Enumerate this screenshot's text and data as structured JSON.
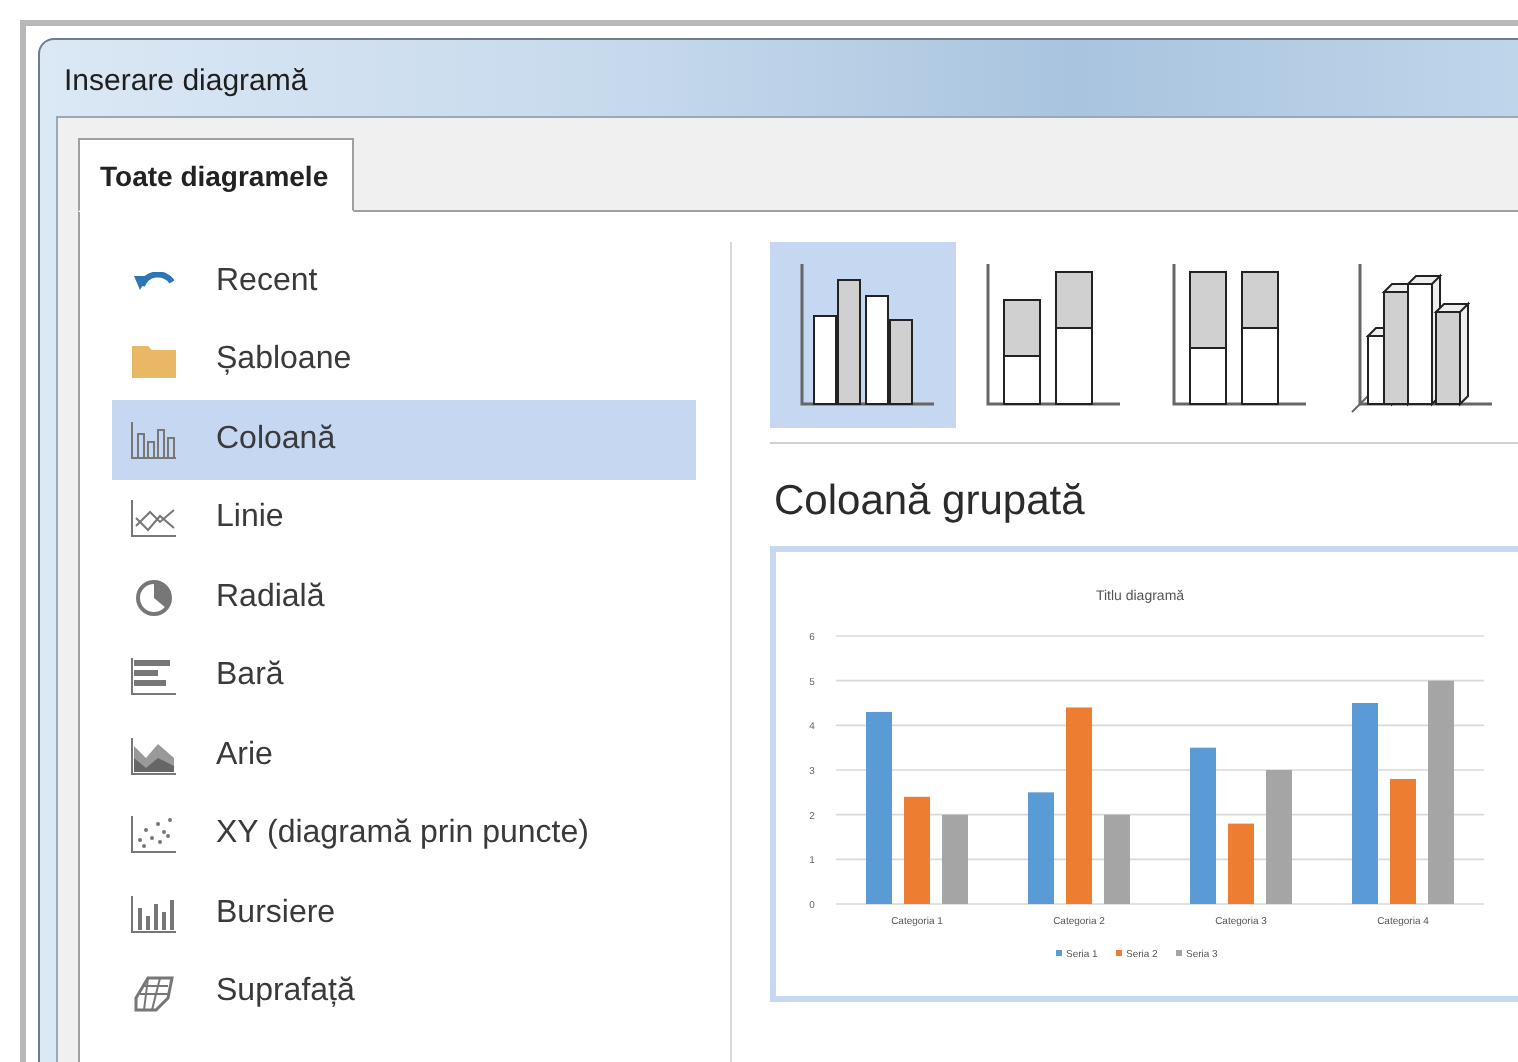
{
  "window": {
    "title": "Inserare diagramă"
  },
  "tabs": [
    {
      "label": "Toate diagramele",
      "selected": true
    }
  ],
  "sidebar": {
    "items": [
      {
        "label": "Recent",
        "kind": "recent",
        "selected": false
      },
      {
        "label": "Șabloane",
        "kind": "templates",
        "selected": false
      },
      {
        "label": "Coloană",
        "kind": "column",
        "selected": true
      },
      {
        "label": "Linie",
        "kind": "line",
        "selected": false
      },
      {
        "label": "Radială",
        "kind": "pie",
        "selected": false
      },
      {
        "label": "Bară",
        "kind": "bar",
        "selected": false
      },
      {
        "label": "Arie",
        "kind": "area",
        "selected": false
      },
      {
        "label": "XY (diagramă prin puncte)",
        "kind": "scatter",
        "selected": false
      },
      {
        "label": "Bursiere",
        "kind": "stock",
        "selected": false
      },
      {
        "label": "Suprafață",
        "kind": "surface",
        "selected": false
      }
    ]
  },
  "chart_types": [
    {
      "kind": "clustered",
      "selected": true
    },
    {
      "kind": "stacked",
      "selected": false
    },
    {
      "kind": "stacked100",
      "selected": false
    },
    {
      "kind": "column3d",
      "selected": false
    }
  ],
  "preview": {
    "heading": "Coloană grupată",
    "chart_data": {
      "type": "bar",
      "title": "Titlu diagramă",
      "categories": [
        "Categoria 1",
        "Categoria 2",
        "Categoria 3",
        "Categoria 4"
      ],
      "series": [
        {
          "name": "Seria 1",
          "color": "#5b9bd5",
          "values": [
            4.3,
            2.5,
            3.5,
            4.5
          ]
        },
        {
          "name": "Seria 2",
          "color": "#ed7d31",
          "values": [
            2.4,
            4.4,
            1.8,
            2.8
          ]
        },
        {
          "name": "Seria 3",
          "color": "#a5a5a5",
          "values": [
            2,
            2,
            3,
            5
          ]
        }
      ],
      "ylim": [
        0,
        6
      ],
      "grid": true,
      "legend": "bottom",
      "yticks": [
        0,
        1,
        2,
        3,
        4,
        5,
        6
      ]
    }
  }
}
